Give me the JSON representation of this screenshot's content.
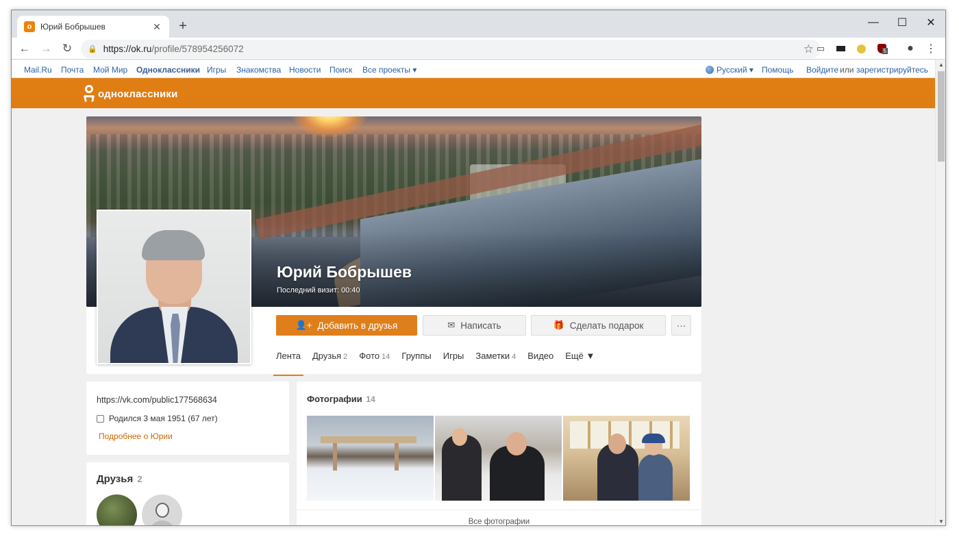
{
  "browser": {
    "tab_title": "Юрий Бобрышев",
    "tab_favicon": "о",
    "url_host": "https://ok.ru",
    "url_path": "/profile/578954256072",
    "extension_badge": "5"
  },
  "portal": {
    "links": [
      "Mail.Ru",
      "Почта",
      "Мой Мир",
      "Одноклассники",
      "Игры",
      "Знакомства",
      "Новости",
      "Поиск",
      "Все проекты ▾"
    ],
    "language": "Русский ▾",
    "help": "Помощь",
    "login": "Войдите",
    "or": "или",
    "register": "зарегистрируйтесь"
  },
  "header": {
    "logo_text": "одноклассники",
    "brand_color": "#e07f14"
  },
  "profile": {
    "name": "Юрий Бобрышев",
    "last_visit": "Последний визит: 00:40"
  },
  "actions": {
    "add_friend": "Добавить в друзья",
    "write": "Написать",
    "gift": "Сделать подарок",
    "more": "···"
  },
  "tabs": [
    {
      "label": "Лента",
      "count": ""
    },
    {
      "label": "Друзья",
      "count": "2"
    },
    {
      "label": "Фото",
      "count": "14"
    },
    {
      "label": "Группы",
      "count": ""
    },
    {
      "label": "Игры",
      "count": ""
    },
    {
      "label": "Заметки",
      "count": "4"
    },
    {
      "label": "Видео",
      "count": ""
    },
    {
      "label": "Ещё ▼",
      "count": ""
    }
  ],
  "info": {
    "link": "https://vk.com/public177568634",
    "birth": "Родился 3 мая 1951 (67 лет)",
    "more": "Подробнее о Юрии"
  },
  "friends": {
    "title": "Друзья",
    "count": "2"
  },
  "photos": {
    "title": "Фотографии",
    "count": "14",
    "all": "Все фотографии"
  }
}
